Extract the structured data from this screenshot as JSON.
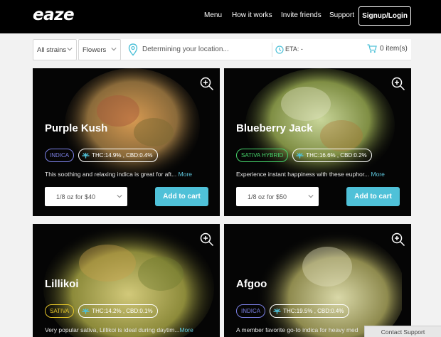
{
  "header": {
    "logo": "eaze",
    "nav": [
      "Menu",
      "How it works",
      "Invite friends",
      "Support"
    ],
    "signup_label": "Signup/Login"
  },
  "filters": {
    "strain_select": "All strains",
    "category_select": "Flowers",
    "location_text": "Determining your location...",
    "eta_text": "ETA: -",
    "cart_text": "0 item(s)"
  },
  "products": [
    {
      "name": "Purple Kush",
      "type": "INDICA",
      "type_color": "#7d82e8",
      "potency": "THC:14.9% , CBD:0.4%",
      "description": "This soothing and relaxing indica is great for aft...",
      "more": "More",
      "size_option": "1/8 oz for $40",
      "cta": "Add to cart",
      "bud_color": "#b07a3a"
    },
    {
      "name": "Blueberry Jack",
      "type": "SATIVA HYBRID",
      "type_color": "#46d46b",
      "potency": "THC:16.6% , CBD:0.2%",
      "description": "Experience instant happiness with these euphor...",
      "more": "More",
      "size_option": "1/8 oz for $50",
      "cta": "Add to cart",
      "bud_color": "#9cb15a"
    },
    {
      "name": "Lillikoi",
      "type": "SATIVA",
      "type_color": "#e7c729",
      "potency": "THC:14.2% , CBD:0.1%",
      "description": "Very popular sativa, Lillikoi is ideal during daytim...",
      "more": "More",
      "bud_color": "#a6a548"
    },
    {
      "name": "Afgoo",
      "type": "INDICA",
      "type_color": "#7d82e8",
      "potency": "THC:19.5% , CBD:0.4%",
      "description": "A member favorite go-to indica for heavy med",
      "bud_color": "#b4b06a"
    }
  ],
  "contact_support": "Contact Support",
  "colors": {
    "accent": "#4fc1d8",
    "header_bg": "#000000"
  }
}
